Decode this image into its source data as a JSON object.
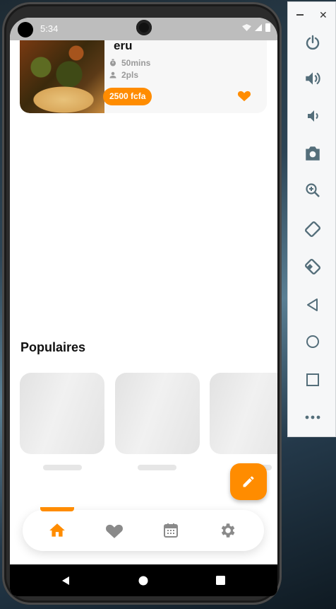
{
  "status_bar": {
    "time": "5:34"
  },
  "recipe": {
    "name": "eru",
    "duration": "50mins",
    "servings": "2pls",
    "price": "2500 fcfa"
  },
  "popular": {
    "title": "Populaires",
    "placeholders": 3
  },
  "colors": {
    "accent": "#ff8c00",
    "text": "#111111",
    "muted": "#9a9a9a",
    "nav_icon": "#8a8a8a"
  },
  "bottom_nav": {
    "items": [
      {
        "icon": "home-icon",
        "active": true
      },
      {
        "icon": "heart-icon",
        "active": false
      },
      {
        "icon": "calendar-icon",
        "active": false
      },
      {
        "icon": "gear-icon",
        "active": false
      }
    ]
  },
  "fab": {
    "icon": "pencil-icon"
  },
  "emulator_panel": {
    "buttons": [
      "power-icon",
      "volume-up-icon",
      "volume-down-icon",
      "camera-icon",
      "zoom-icon",
      "rotate-left-icon",
      "rotate-right-icon",
      "back-icon",
      "home-icon",
      "overview-icon",
      "more-icon"
    ]
  }
}
